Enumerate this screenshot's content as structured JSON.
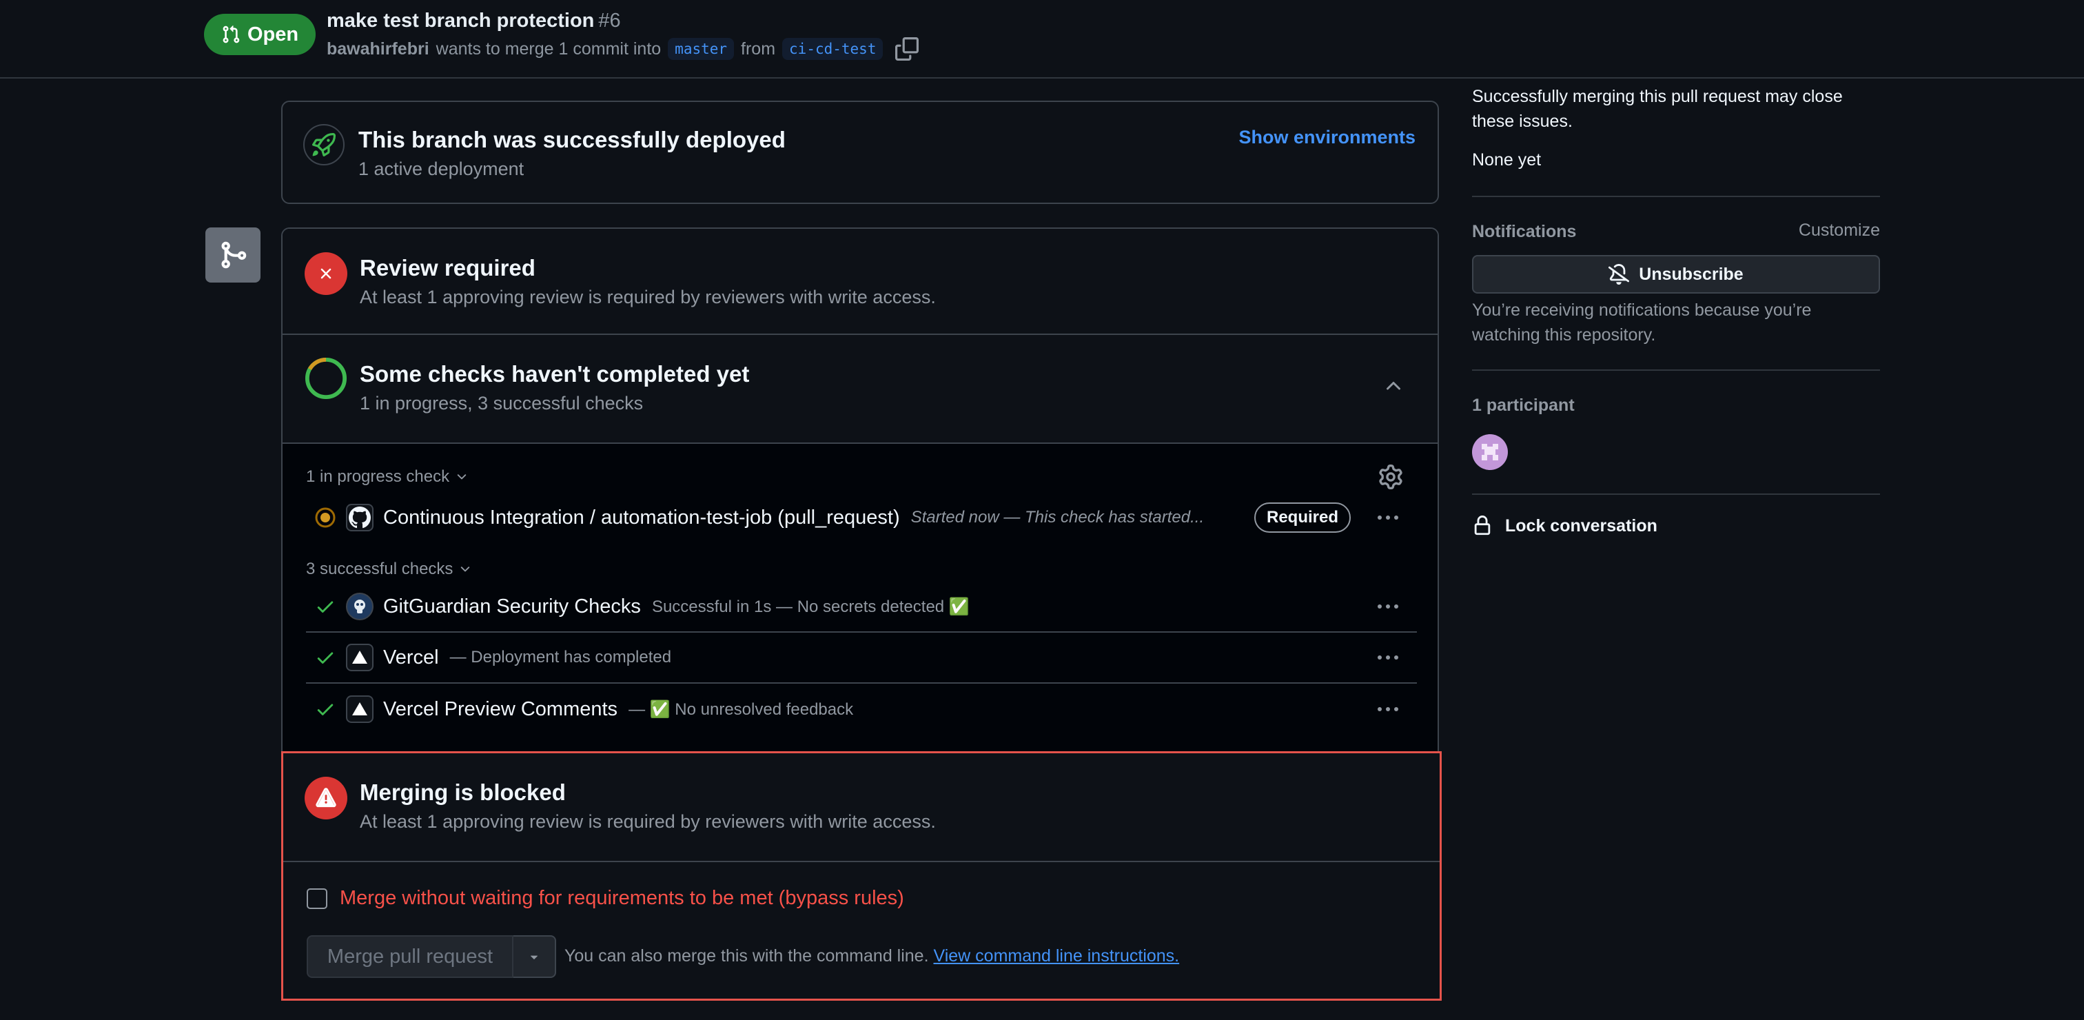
{
  "header": {
    "state_label": "Open",
    "title": "make test branch protection",
    "number": "#6",
    "author": "bawahirfebri",
    "merge_text": "wants to merge 1 commit into",
    "base_branch": "master",
    "from_text": "from",
    "head_branch": "ci-cd-test"
  },
  "deployment": {
    "title": "This branch was successfully deployed",
    "subtitle": "1 active deployment",
    "link": "Show environments"
  },
  "review": {
    "title": "Review required",
    "subtitle": "At least 1 approving review is required by reviewers with write access."
  },
  "checks": {
    "title": "Some checks haven't completed yet",
    "subtitle": "1 in progress, 3 successful checks",
    "in_progress_label": "1 in progress check",
    "successful_label": "3 successful checks",
    "in_progress": [
      {
        "name": "Continuous Integration / automation-test-job (pull_request)",
        "description": "Started now — This check has started...",
        "badge": "Required"
      }
    ],
    "successful": [
      {
        "name": "GitGuardian Security Checks",
        "description": "Successful in 1s — No secrets detected ✅"
      },
      {
        "name": "Vercel",
        "description": "— Deployment has completed"
      },
      {
        "name": "Vercel Preview Comments",
        "description": "— ✅ No unresolved feedback"
      }
    ]
  },
  "blocked": {
    "title": "Merging is blocked",
    "subtitle": "At least 1 approving review is required by reviewers with write access.",
    "bypass_label": "Merge without waiting for requirements to be met (bypass rules)",
    "merge_button": "Merge pull request",
    "cmd_text": "You can also merge this with the command line.",
    "cmd_link": "View command line instructions."
  },
  "sidebar": {
    "issues_text": "Successfully merging this pull request may close these issues.",
    "issues_value": "None yet",
    "notifications_heading": "Notifications",
    "customize": "Customize",
    "unsubscribe": "Unsubscribe",
    "notify_reason": "You’re receiving notifications because you’re watching this repository.",
    "participants": "1 participant",
    "lock": "Lock conversation"
  },
  "colors": {
    "open_badge": "#238636",
    "danger": "#da3633",
    "success": "#3fb950",
    "pending": "#d29922",
    "link": "#4493f8",
    "blocked_border": "#e5534b"
  }
}
